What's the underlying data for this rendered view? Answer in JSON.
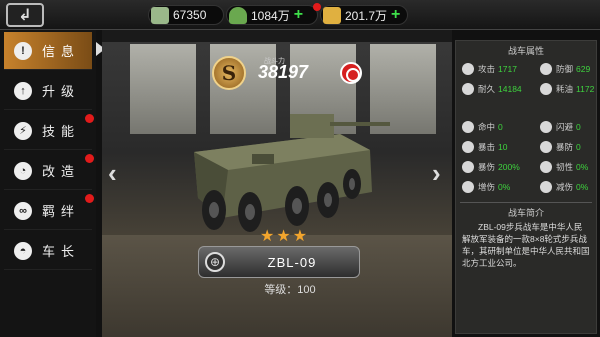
{
  "topbar": {
    "back_label": "↲",
    "resources": [
      {
        "name": "cash",
        "value": "67350",
        "icon": "cash-icon",
        "color": "#9ab88a"
      },
      {
        "name": "oil",
        "value": "1084万",
        "icon": "oil-barrel-icon",
        "color": "#6aa84f"
      },
      {
        "name": "gold",
        "value": "201.7万",
        "icon": "gold-bars-icon",
        "color": "#e0b040"
      }
    ],
    "plus_label": "+"
  },
  "sidebar": {
    "items": [
      {
        "label": "信息",
        "icon": "info-icon",
        "glyph": "!",
        "active": true,
        "alert": false
      },
      {
        "label": "升级",
        "icon": "upgrade-icon",
        "glyph": "↑",
        "active": false,
        "alert": false
      },
      {
        "label": "技能",
        "icon": "skill-icon",
        "glyph": "⚡",
        "active": false,
        "alert": true
      },
      {
        "label": "改造",
        "icon": "modify-icon",
        "glyph": "◔",
        "active": false,
        "alert": true
      },
      {
        "label": "羁绊",
        "icon": "bond-icon",
        "glyph": "∞",
        "active": false,
        "alert": true
      },
      {
        "label": "车长",
        "icon": "commander-icon",
        "glyph": "◓",
        "active": false,
        "alert": false
      }
    ]
  },
  "vehicle": {
    "rank": "S",
    "power_label": "战斗力",
    "power": "38197",
    "stars": [
      "★",
      "★",
      "★"
    ],
    "name": "ZBL-09",
    "level_text": "等级：100",
    "nav_left": "‹",
    "nav_right": "›",
    "zoom_glyph": "⊕"
  },
  "panel": {
    "stats_title": "战车属性",
    "stats": [
      {
        "label": "攻击",
        "value": "1717",
        "icon": "attack-icon"
      },
      {
        "label": "防御",
        "value": "629",
        "icon": "defense-icon"
      },
      {
        "label": "耐久",
        "value": "14184",
        "icon": "durability-icon"
      },
      {
        "label": "耗油",
        "value": "1172",
        "icon": "fuel-icon"
      },
      {
        "label": "命中",
        "value": "0",
        "icon": "hit-icon"
      },
      {
        "label": "闪避",
        "value": "0",
        "icon": "dodge-icon"
      },
      {
        "label": "暴击",
        "value": "10",
        "icon": "crit-icon"
      },
      {
        "label": "暴防",
        "value": "0",
        "icon": "crit-defense-icon"
      },
      {
        "label": "暴伤",
        "value": "200%",
        "icon": "crit-damage-icon"
      },
      {
        "label": "韧性",
        "value": "0%",
        "icon": "toughness-icon"
      },
      {
        "label": "增伤",
        "value": "0%",
        "icon": "damage-bonus-icon"
      },
      {
        "label": "减伤",
        "value": "0%",
        "icon": "damage-reduction-icon"
      }
    ],
    "desc_title": "战车简介",
    "description": "ZBL-09步兵战车是中华人民解放军装备的一款8×8轮式步兵战车，其研制单位是中华人民共和国北方工业公司。"
  }
}
